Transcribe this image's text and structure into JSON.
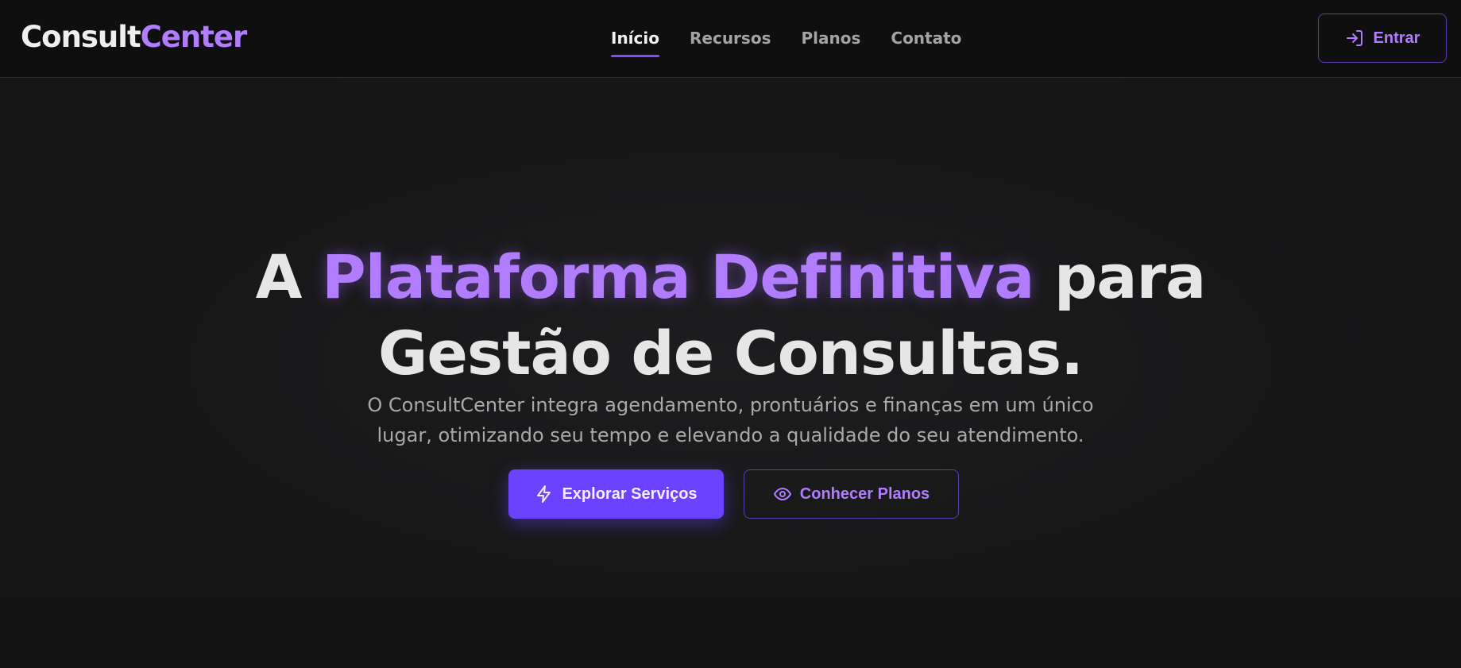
{
  "header": {
    "logo": {
      "part1": "Consult",
      "part2": "Center"
    },
    "nav": [
      {
        "label": "Início",
        "active": true
      },
      {
        "label": "Recursos",
        "active": false
      },
      {
        "label": "Planos",
        "active": false
      },
      {
        "label": "Contato",
        "active": false
      }
    ],
    "login": {
      "label": "Entrar",
      "icon": "log-in-icon"
    }
  },
  "hero": {
    "headline": {
      "prefix": "A ",
      "accent": "Plataforma Definitiva",
      "suffix": " para",
      "line2": "Gestão de Consultas."
    },
    "subtitle_line1": "O ConsultCenter integra agendamento, prontuários e finanças em um único",
    "subtitle_line2": "lugar, otimizando seu tempo e elevando a qualidade do seu atendimento.",
    "primary_cta": {
      "label": "Explorar Serviços",
      "icon": "lightning-icon"
    },
    "secondary_cta": {
      "label": "Conhecer Planos",
      "icon": "eye-icon"
    }
  },
  "colors": {
    "background": "#141414",
    "header_bg": "#0f0f10",
    "accent": "#b27cff",
    "primary": "#6a42ff",
    "text": "#e6e6e6",
    "muted": "#a9a9a9"
  }
}
